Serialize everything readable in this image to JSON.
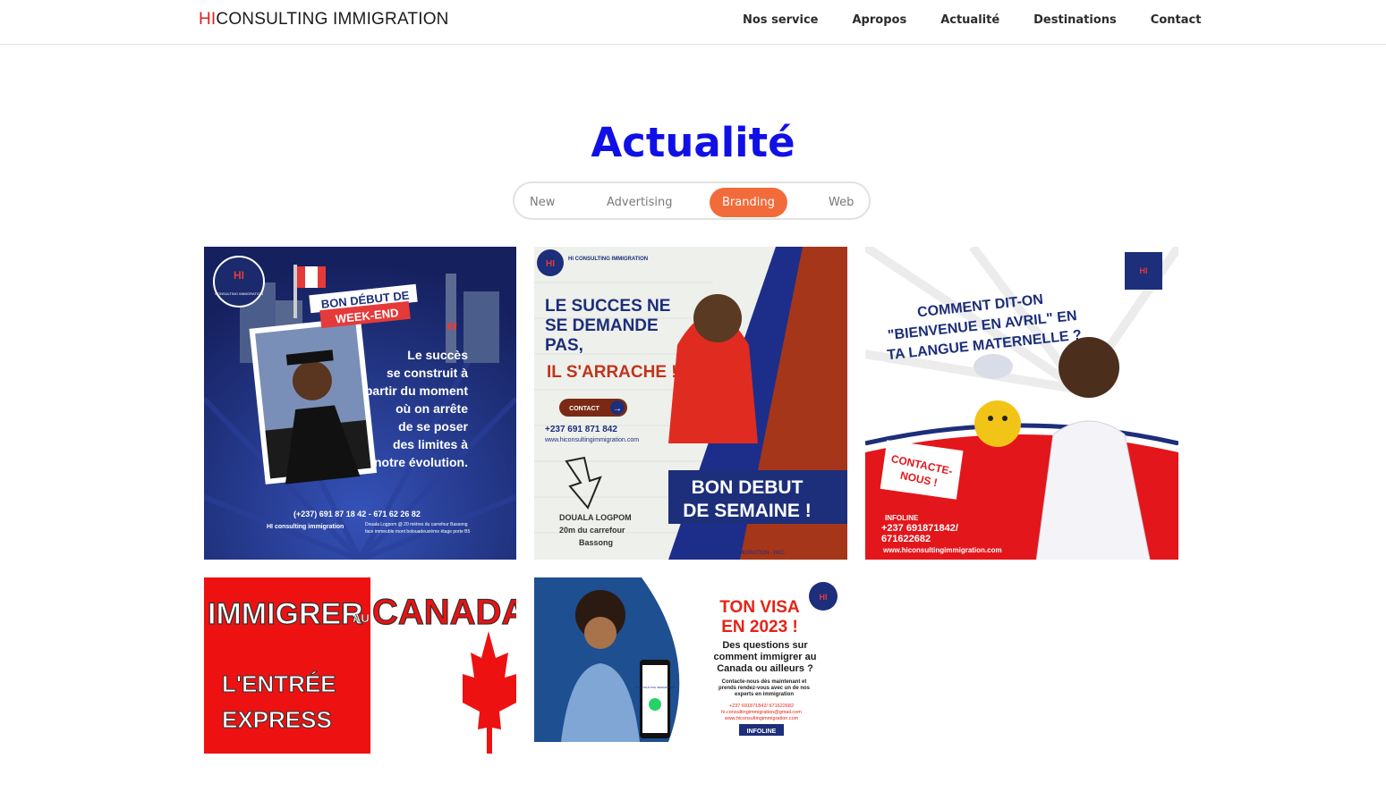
{
  "brand": {
    "prefix": "HI",
    "name": "CONSULTING IMMIGRATION"
  },
  "nav": {
    "items": [
      {
        "label": "Nos service"
      },
      {
        "label": "Apropos"
      },
      {
        "label": "Actualité"
      },
      {
        "label": "Destinations"
      },
      {
        "label": "Contact"
      }
    ]
  },
  "section": {
    "title": "Actualité"
  },
  "filters": {
    "items": [
      {
        "label": "New"
      },
      {
        "label": "Advertising"
      },
      {
        "label": "Branding"
      },
      {
        "label": "Web"
      }
    ],
    "active": "Branding"
  },
  "colors": {
    "accent": "#f26b3a",
    "title": "#1010e6",
    "brand_red": "#e02020",
    "card1_bg": "#1d2e7a",
    "card2_accent": "#c0341a",
    "card3_red": "#e3161b",
    "card4_red": "#ee1111"
  },
  "gallery": {
    "card1": {
      "logo_text": "CONSULTING IMMIGRATION",
      "banner_1": "BON DÉBUT DE",
      "banner_2": "WEEK-END",
      "quote_lines": [
        "Le succès",
        "se construit à",
        "partir du moment",
        "où on arrête",
        "de se poser",
        "des limites à",
        "notre évolution."
      ],
      "phone": "(+237) 691 87 18 42 - 671 62 26 82",
      "address": "Douala Logpom @ 20 mètres du carrefour Bassong",
      "address_2": "face immeuble mont bolouadeuxième étage porte B5",
      "social": "HI consulting immigration"
    },
    "card2": {
      "logo_text": "HI CONSULTING IMMIGRATION",
      "headline_1": "LE SUCCES NE",
      "headline_2": "SE DEMANDE",
      "headline_3": "PAS,",
      "headline_4": "IL S'ARRACHE !",
      "contact_button": "CONTACT",
      "phone": "+237 691 871 842",
      "website": "www.hiconsultingimmigration.com",
      "location_1": "DOUALA LOGPOM",
      "location_2": "20m du carrefour",
      "location_3": "Bassong",
      "banner_1": "BON DEBUT",
      "banner_2": "DE SEMAINE !",
      "footer": "HI CONSULTING IMMIGRATION - HICI"
    },
    "card3": {
      "question_1": "COMMENT DIT-ON",
      "question_2": "\"BIENVENUE EN AVRIL\" EN",
      "question_3": "TA LANGUE MATERNELLE ?",
      "contact_1": "CONTACTE-",
      "contact_2": "NOUS !",
      "infoline": "INFOLINE",
      "phone_1": "+237 691871842/",
      "phone_2": "671622682",
      "website": "www.hiconsultingimmigration.com"
    },
    "card4": {
      "title_1": "IMMIGRER",
      "title_au": "AU",
      "title_2": "CANADA",
      "subtitle_1": "L'ENTRÉE",
      "subtitle_2": "EXPRESS"
    },
    "card5": {
      "headline_1": "TON VISA",
      "headline_2": "EN 2023 !",
      "q1": "Des questions sur",
      "q2": "comment immigrer au",
      "q3": "Canada ou ailleurs ?",
      "c1": "Contacte-nous dès maintenant et",
      "c2": "prends rendez-vous avec un de nos",
      "c3": "experts en immigration",
      "phone": "+237 691871842/ 671622682",
      "email": "hi.consultingimmigration@gmail.com",
      "website": "www.hiconsultingimmigration.com",
      "infoline": "INFOLINE",
      "phone_screen": "HI CONSULTING IMMIGRATION"
    }
  }
}
